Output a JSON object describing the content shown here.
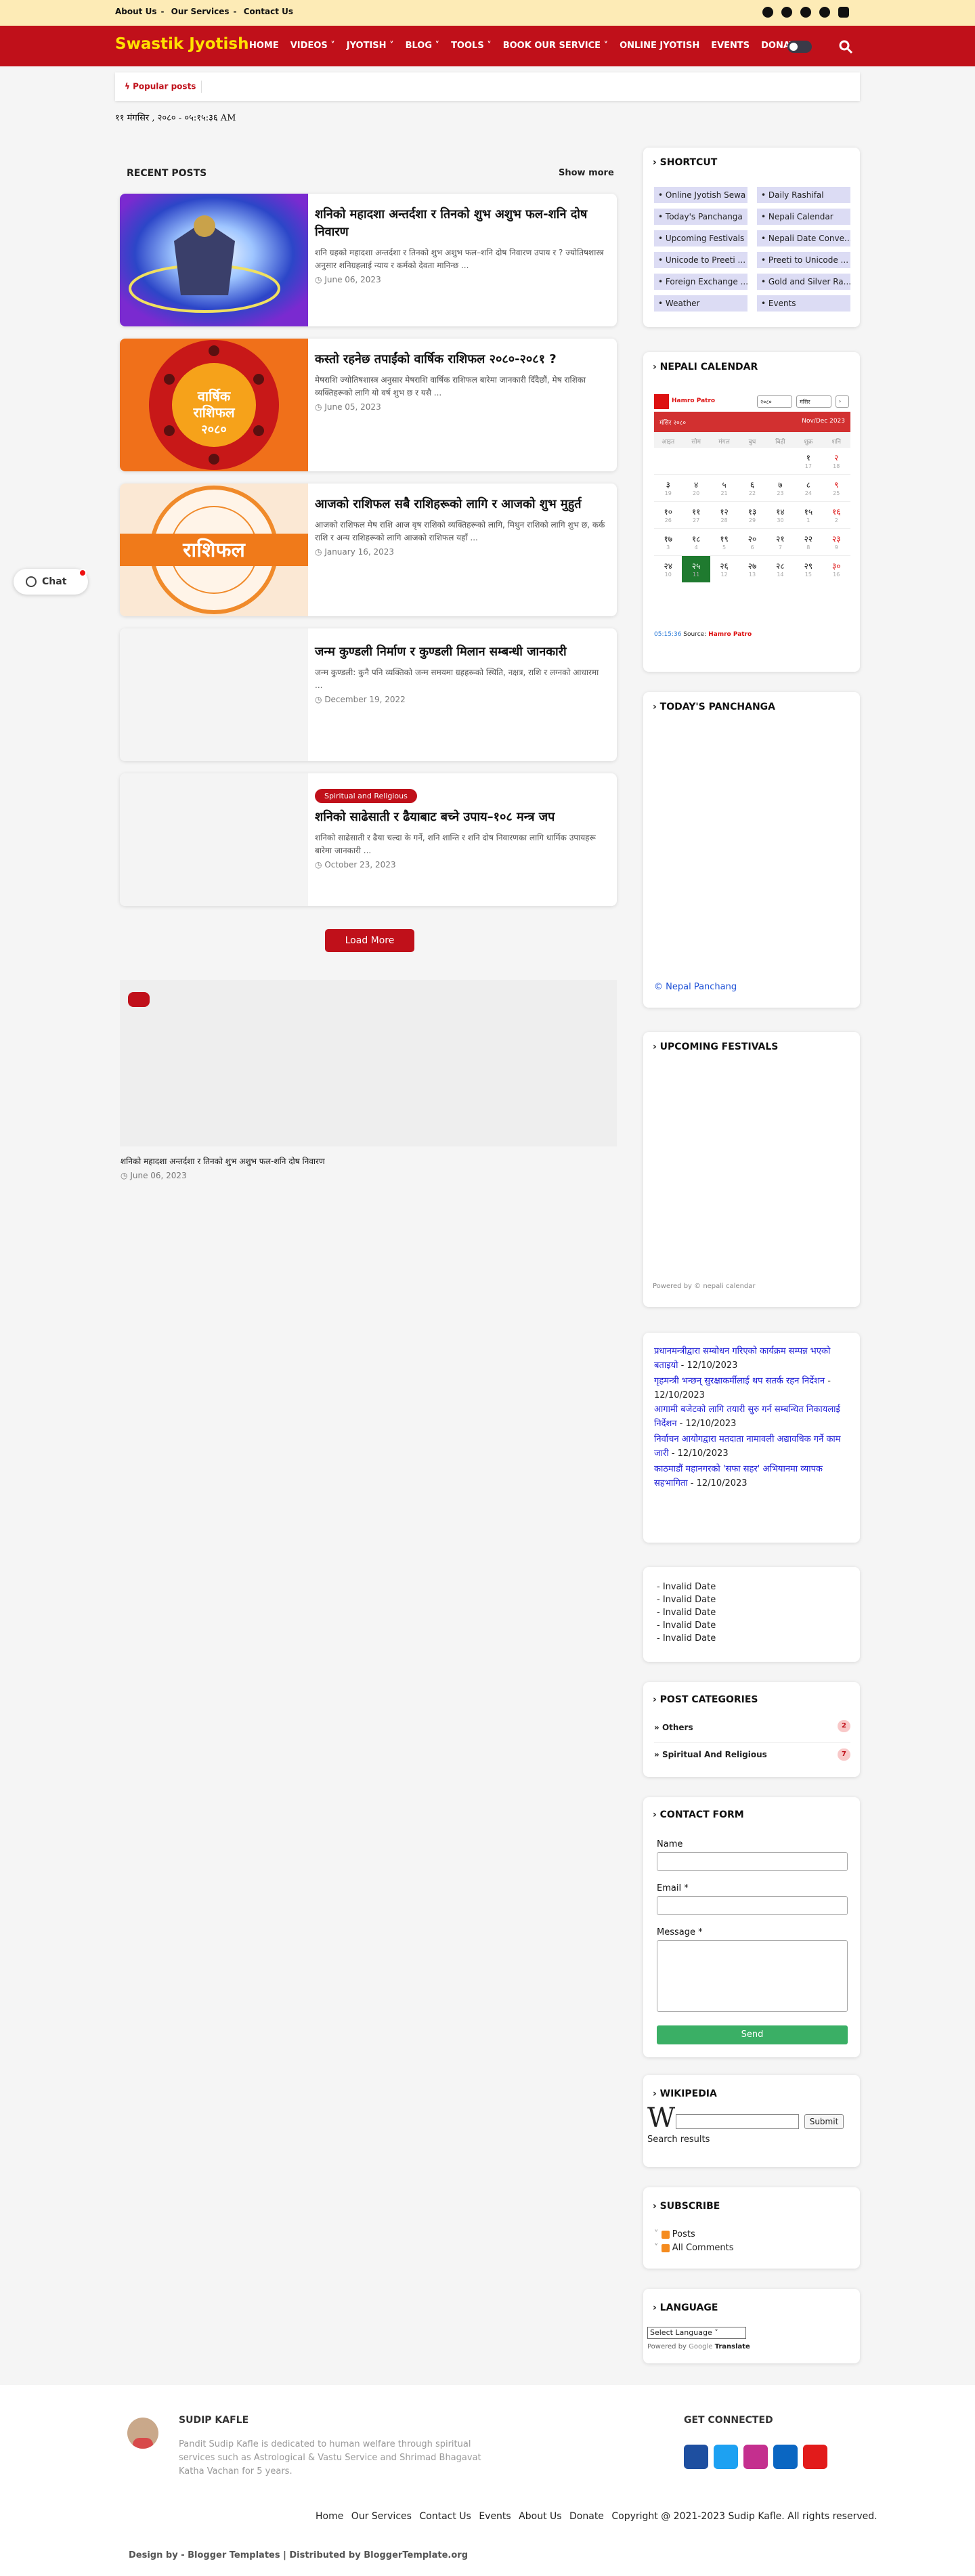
{
  "topbar": {
    "links": [
      "About Us",
      "Our Services",
      "Contact Us"
    ],
    "social_icons": [
      "facebook-icon",
      "twitter-icon",
      "instagram-icon",
      "linkedin-icon",
      "youtube-icon"
    ]
  },
  "nav": {
    "logo": "Swastik Jyotish",
    "items": [
      "HOME",
      "VIDEOS ˅",
      "JYOTISH ˅",
      "BLOG ˅",
      "TOOLS ˅",
      "BOOK OUR SERVICE ˅",
      "ONLINE JYOTISH",
      "EVENTS",
      "DONAT"
    ]
  },
  "popular": {
    "label": "Popular posts"
  },
  "clock": "११ मंगसिर , २०८० - ०५:१५:३६ AM",
  "recent": {
    "heading": "RECENT POSTS",
    "show_more": "Show more",
    "posts": [
      {
        "title": "शनिको महादशा अन्तर्दशा र तिनको शुभ अशुभ फल-शनि दोष निवारण",
        "excerpt": "शनि ग्रहको महादशा अन्तर्दशा र तिनको शुभ अशुभ फल–शनि दोष निवारण उपाय र ? ज्योतिषशास्त्र अनुसार शनिग्रहलाई न्याय र कर्मको देवता मानिन्छ ...",
        "date": "June 06, 2023"
      },
      {
        "title": "कस्तो रहनेछ तपाईंको वार्षिक राशिफल २०८०-२०८१ ?",
        "excerpt": "मेषराशि ज्योतिषशास्त्र अनुसार मेषराशि वार्षिक राशिफल बारेमा जानकारी दिँदैछौं, मेष राशिका व्यक्तिहरूको लागि यो वर्ष शुभ छ र यसै ...",
        "date": "June 05, 2023"
      },
      {
        "title": "आजको राशिफल सबै राशिहरूको लागि र आजको शुभ मुहुर्त",
        "excerpt": "आजको राशिफल मेष राशि आज वृष राशिको व्यक्तिहरूको लागि, मिथुन राशिको लागि शुभ छ, कर्क राशि र अन्य राशिहरूको लागि आजको राशिफल यहाँ ...",
        "date": "January 16, 2023"
      },
      {
        "title": "जन्म कुण्डली निर्माण र कुण्डली मिलान सम्बन्धी जानकारी",
        "excerpt": "जन्म कुण्डली: कुनै पनि व्यक्तिको जन्म समयमा ग्रहहरूको स्थिति, नक्षत्र, राशि र लग्नको आधारमा ...",
        "date": "December 19, 2022"
      },
      {
        "title": "शनिको साढेसाती र ढैयाबाट बच्ने उपाय–१०८ मन्त्र जप",
        "excerpt": "शनिको साढेसाती र ढैया चल्दा के गर्ने, शनि शान्ति र शनि दोष निवारणका लागि धार्मिक उपायहरू बारेमा जानकारी ...",
        "date": "October 23, 2023",
        "badge": "Spiritual and Religious"
      }
    ],
    "load_more": "Load More"
  },
  "featured": {
    "title": "शनिको महादशा अन्तर्दशा र तिनको शुभ अशुभ फल-शनि दोष निवारण",
    "date": "June 06, 2023"
  },
  "chat": {
    "label": "Chat"
  },
  "sidebar": {
    "shortcut": {
      "title": "SHORTCUT",
      "items": [
        "Online Jyotish Sewa",
        "Daily Rashifal",
        "Today's Panchanga",
        "Nepali Calendar",
        "Upcoming Festivals",
        "Nepali Date Conve...",
        "Unicode to Preeti ...",
        "Preeti to Unicode ...",
        "Foreign Exchange ...",
        "Gold and Silver Ra...",
        "Weather",
        "Events"
      ]
    },
    "calendar": {
      "title": "NEPALI CALENDAR",
      "brand": "Hamro Patro",
      "year": "२०८०",
      "month": "मंसिर",
      "header_left": "मंसिर २०८०",
      "header_right": "Nov/Dec 2023",
      "weekdays": [
        "आइत",
        "सोम",
        "मंगल",
        "बुध",
        "बिही",
        "शुक्र",
        "शनि"
      ],
      "days": [
        {
          "n": "",
          "e": ""
        },
        {
          "n": "",
          "e": ""
        },
        {
          "n": "",
          "e": ""
        },
        {
          "n": "",
          "e": ""
        },
        {
          "n": "",
          "e": ""
        },
        {
          "n": "१",
          "e": "17"
        },
        {
          "n": "२",
          "e": "18"
        },
        {
          "n": "३",
          "e": "19"
        },
        {
          "n": "४",
          "e": "20"
        },
        {
          "n": "५",
          "e": "21"
        },
        {
          "n": "६",
          "e": "22"
        },
        {
          "n": "७",
          "e": "23"
        },
        {
          "n": "८",
          "e": "24"
        },
        {
          "n": "९",
          "e": "25"
        },
        {
          "n": "१०",
          "e": "26"
        },
        {
          "n": "११",
          "e": "27"
        },
        {
          "n": "१२",
          "e": "28"
        },
        {
          "n": "१३",
          "e": "29"
        },
        {
          "n": "१४",
          "e": "30"
        },
        {
          "n": "१५",
          "e": "1"
        },
        {
          "n": "१६",
          "e": "2"
        },
        {
          "n": "१७",
          "e": "3"
        },
        {
          "n": "१८",
          "e": "4"
        },
        {
          "n": "१९",
          "e": "5"
        },
        {
          "n": "२०",
          "e": "6"
        },
        {
          "n": "२१",
          "e": "7"
        },
        {
          "n": "२२",
          "e": "8"
        },
        {
          "n": "२३",
          "e": "9"
        },
        {
          "n": "२४",
          "e": "10"
        },
        {
          "n": "२५",
          "e": "11"
        },
        {
          "n": "२६",
          "e": "12"
        },
        {
          "n": "२७",
          "e": "13"
        },
        {
          "n": "२८",
          "e": "14"
        },
        {
          "n": "२९",
          "e": "15"
        },
        {
          "n": "३०",
          "e": "16"
        }
      ],
      "time": "05:15:36",
      "source_label": "Source:",
      "source": "Hamro Patro"
    },
    "panchanga": {
      "title": "TODAY'S PANCHANGA",
      "credit": "© Nepal Panchang"
    },
    "festivals": {
      "title": "UPCOMING FESTIVALS",
      "credit": "Powered by © nepali calendar"
    },
    "news": [
      {
        "text": "प्रधानमन्त्रीद्वारा सम्बोधन गरिएको कार्यक्रम सम्पन्न भएको बताइयो",
        "date": " - 12/10/2023"
      },
      {
        "text": "गृहमन्त्री भन्छन् सुरक्षाकर्मीलाई थप सतर्क रहन निर्देशन",
        "date": " - 12/10/2023"
      },
      {
        "text": "आगामी बजेटको लागि तयारी सुरु गर्न सम्बन्धित निकायलाई निर्देशन",
        "date": " - 12/10/2023"
      },
      {
        "text": "निर्वाचन आयोगद्वारा मतदाता नामावली अद्यावधिक गर्ने काम जारी",
        "date": " - 12/10/2023"
      },
      {
        "text": "काठमाडौं महानगरको 'सफा सहर' अभियानमा व्यापक सहभागिता",
        "date": " - 12/10/2023"
      }
    ],
    "invalid_dates": [
      "- Invalid Date",
      "- Invalid Date",
      "- Invalid Date",
      "- Invalid Date",
      "- Invalid Date"
    ],
    "categories": {
      "title": "POST CATEGORIES",
      "items": [
        {
          "name": "Others",
          "count": "2"
        },
        {
          "name": "Spiritual And Religious",
          "count": "7"
        }
      ]
    },
    "contact": {
      "title": "CONTACT FORM",
      "name_label": "Name",
      "email_label": "Email *",
      "message_label": "Message *",
      "send": "Send"
    },
    "wikipedia": {
      "title": "WIKIPEDIA",
      "button": "Submit",
      "results": "Search results"
    },
    "subscribe": {
      "title": "SUBSCRIBE",
      "posts": "Posts",
      "comments": "All Comments"
    },
    "language": {
      "title": "LANGUAGE",
      "select": "Select Language",
      "powered": "Powered by",
      "google": "Google",
      "translate": "Translate"
    }
  },
  "footer": {
    "author": "SUDIP KAFLE",
    "bio": "Pandit Sudip Kafle is dedicated to human welfare through spiritual services such as Astrological & Vastu Service and Shrimad Bhagavat Katha Vachan for 5 years.",
    "get_connected": "GET CONNECTED",
    "links": [
      "Home",
      "Our Services",
      "Contact Us",
      "Events",
      "About Us",
      "Donate"
    ],
    "copyright": "Copyright @ 2021-2023 Sudip Kafle. All rights reserved.",
    "credit_prefix": "Design by - ",
    "credit_designer": "Blogger Templates",
    "credit_mid": " | Distributed by ",
    "credit_distributor": "BloggerTemplate.org"
  }
}
